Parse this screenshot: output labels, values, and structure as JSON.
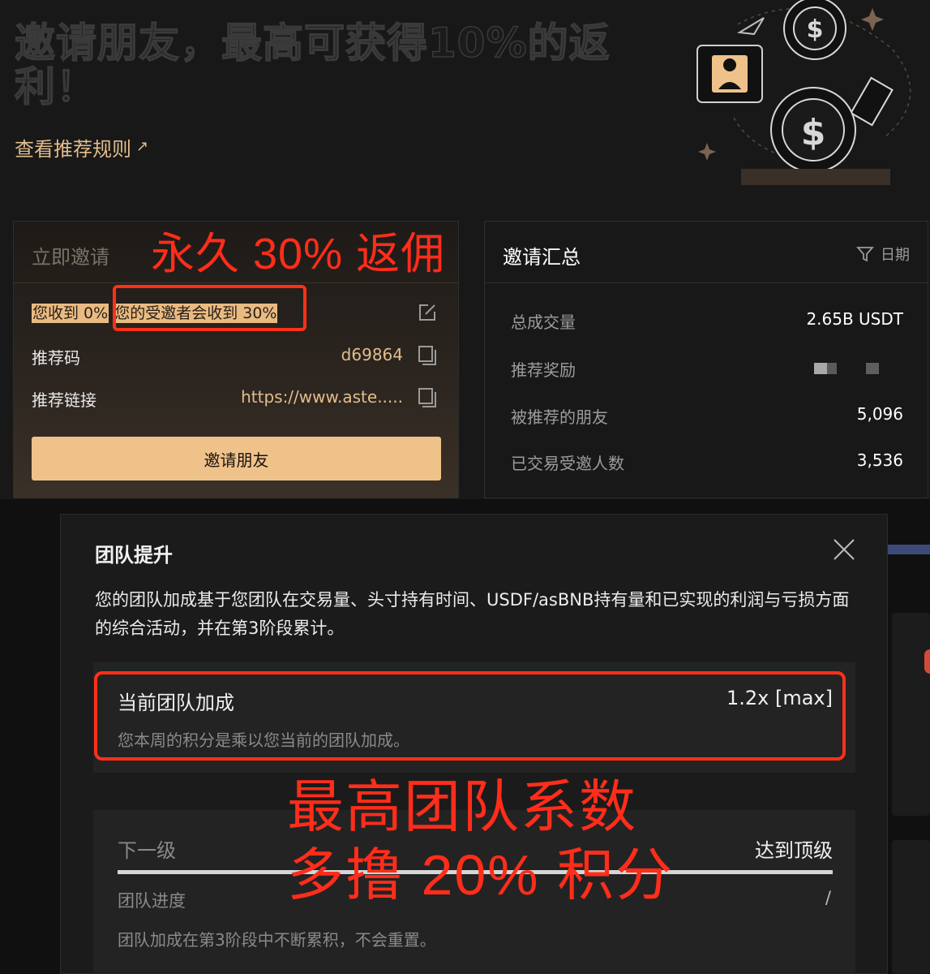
{
  "hero": {
    "title": "邀请朋友，最高可获得10%的返利！",
    "rules_link": "查看推荐规则",
    "rules_arrow": "↗"
  },
  "invite": {
    "title": "立即邀请",
    "you_receive": "您收到 0%",
    "invitee_receives": "您的受邀者会收到 30%",
    "referral_code_label": "推荐码",
    "referral_code": "d69864",
    "referral_link_label": "推荐链接",
    "referral_link": "https://www.aste.....",
    "button": "邀请朋友"
  },
  "summary": {
    "title": "邀请汇总",
    "filter_label": "日期",
    "rows": [
      {
        "label": "总成交量",
        "value": "2.65B USDT"
      },
      {
        "label": "推荐奖励",
        "value": ""
      },
      {
        "label": "被推荐的朋友",
        "value": "5,096"
      },
      {
        "label": "已交易受邀人数",
        "value": "3,536"
      }
    ]
  },
  "modal": {
    "title": "团队提升",
    "description": "您的团队加成基于您团队在交易量、头寸持有时间、USDF/asBNB持有量和已实现的利润与亏损方面的综合活动，并在第3阶段累计。",
    "current_bonus_label": "当前团队加成",
    "current_bonus_value": "1.2x [max]",
    "current_bonus_note": "您本周的积分是乘以您当前的团队加成。",
    "next_level_label": "下一级",
    "next_level_value": "达到顶级",
    "progress_label": "团队进度",
    "progress_value": "/",
    "progress_fraction": 1.0,
    "accum_note": "团队加成在第3阶段中不断累积，不会重置。"
  },
  "annotations": {
    "permanent_rebate": "永久 30% 返佣",
    "max_team_line1": "最高团队系数",
    "max_team_line2": "多撸 20% 积分"
  },
  "colors": {
    "accent": "#e2bc8c",
    "button": "#efc28a",
    "annotation_red": "#ff2d1a",
    "background": "#181818"
  }
}
